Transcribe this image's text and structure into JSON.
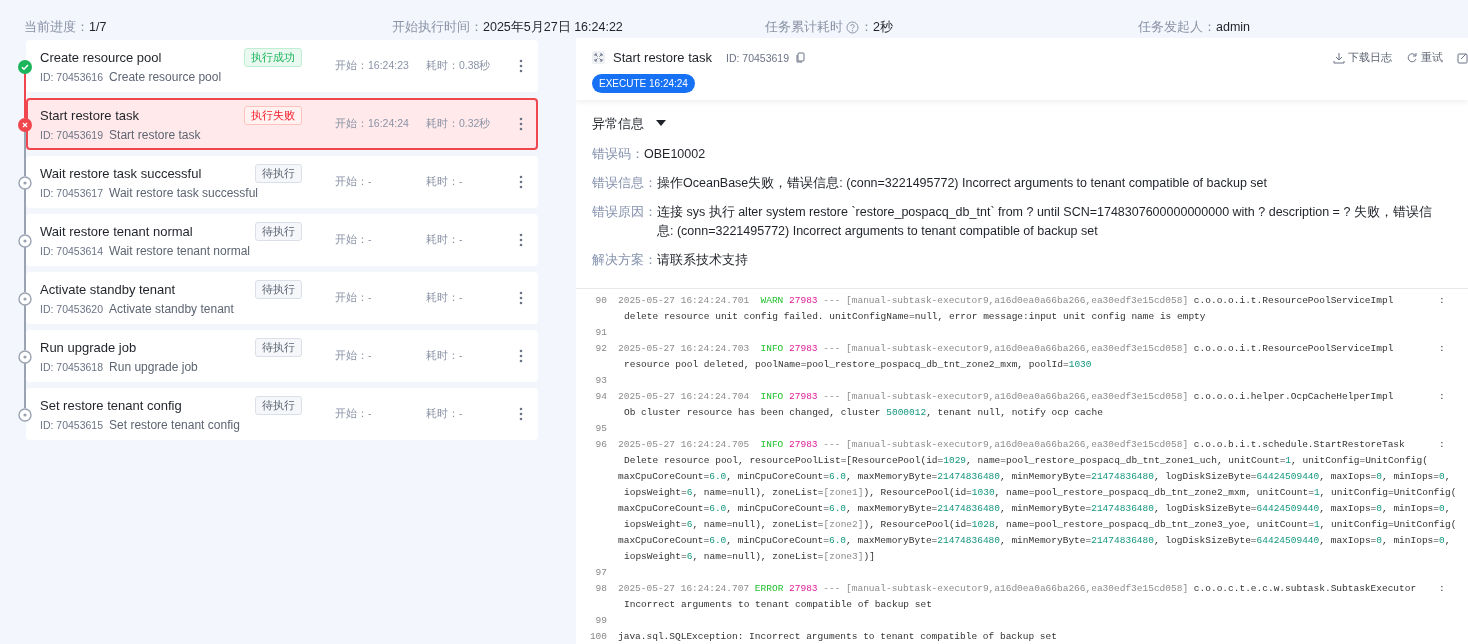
{
  "summary": [
    {
      "label": "当前进度：",
      "value": "1/7"
    },
    {
      "label": "开始执行时间：",
      "value": "2025年5月27日 16:24:22"
    },
    {
      "label": "任务累计耗时",
      "help": true,
      "label_after": "：",
      "value": "2秒"
    },
    {
      "label": "任务发起人：",
      "value": "admin"
    }
  ],
  "steps": [
    {
      "title": "Create resource pool",
      "kind": "success",
      "tag": "执行成功",
      "id": "ID: 70453616",
      "name": "Create resource pool",
      "start": "开始：16:24:23",
      "duration": "耗时：0.38秒",
      "selected": false
    },
    {
      "title": "Start restore task",
      "kind": "failed",
      "tag": "执行失败",
      "id": "ID: 70453619",
      "name": "Start restore task",
      "start": "开始：16:24:24",
      "duration": "耗时：0.32秒",
      "selected": true
    },
    {
      "title": "Wait restore task successful",
      "kind": "pending",
      "tag": "待执行",
      "id": "ID: 70453617",
      "name": "Wait restore task successful",
      "start": "开始：-",
      "duration": "耗时：-",
      "selected": false
    },
    {
      "title": "Wait restore tenant normal",
      "kind": "pending",
      "tag": "待执行",
      "id": "ID: 70453614",
      "name": "Wait restore tenant normal",
      "start": "开始：-",
      "duration": "耗时：-",
      "selected": false
    },
    {
      "title": "Activate standby tenant",
      "kind": "pending",
      "tag": "待执行",
      "id": "ID: 70453620",
      "name": "Activate standby tenant",
      "start": "开始：-",
      "duration": "耗时：-",
      "selected": false
    },
    {
      "title": "Run upgrade job",
      "kind": "pending",
      "tag": "待执行",
      "id": "ID: 70453618",
      "name": "Run upgrade job",
      "start": "开始：-",
      "duration": "耗时：-",
      "selected": false
    },
    {
      "title": "Set restore tenant config",
      "kind": "pending",
      "tag": "待执行",
      "id": "ID: 70453615",
      "name": "Set restore tenant config",
      "start": "开始：-",
      "duration": "耗时：-",
      "selected": false
    }
  ],
  "detail": {
    "title": "Start restore task",
    "id": "ID: 70453619",
    "actions": [
      "下载日志",
      "重试"
    ],
    "badge": "EXECUTE 16:24:24"
  },
  "error_info": {
    "title": "异常信息",
    "expanded": true,
    "rows": [
      {
        "label": "错误码：",
        "value": "OBE10002"
      },
      {
        "label": "错误信息：",
        "value": "操作OceanBase失败，错误信息: (conn=3221495772) Incorrect arguments to tenant compatible of backup set"
      },
      {
        "label": "错误原因：",
        "value": "连接 sys 执行 alter system restore `restore_pospacq_db_tnt` from ? until SCN=1748307600000000000 with ? description = ? 失败，错误信息: (conn=3221495772) Incorrect arguments to tenant compatible of backup set"
      },
      {
        "label": "解决方案：",
        "value": "请联系技术支持"
      }
    ]
  },
  "log": [
    {
      "no": "90",
      "kind": "record",
      "time": "2025-05-27 16:24:24.701",
      "level": "WARN",
      "pid": "27983",
      "sep": "---",
      "thread": "[manual-subtask-executor9,a16d0ea0a66ba266,ea30edf3e15cd058]",
      "logger": "c.o.o.o.i.t.ResourcePoolServiceImpl",
      "colon": ":",
      "body": [
        [
          {
            "kind": "text",
            "text": "delete resource unit config failed. unitConfigName=null, error message:input unit config name is empty"
          }
        ]
      ]
    },
    {
      "no": "91",
      "kind": "blank"
    },
    {
      "no": "92",
      "kind": "record",
      "time": "2025-05-27 16:24:24.703",
      "level": "INFO",
      "pid": "27983",
      "sep": "---",
      "thread": "[manual-subtask-executor9,a16d0ea0a66ba266,ea30edf3e15cd058]",
      "logger": "c.o.o.o.i.t.ResourcePoolServiceImpl",
      "colon": ":",
      "body": [
        [
          {
            "kind": "text",
            "text": "resource pool deleted, poolName=pool_restore_pospacq_db_tnt_zone2_mxm, poolId="
          },
          {
            "kind": "num",
            "text": "1030"
          }
        ]
      ]
    },
    {
      "no": "93",
      "kind": "blank"
    },
    {
      "no": "94",
      "kind": "record",
      "time": "2025-05-27 16:24:24.704",
      "level": "INFO",
      "pid": "27983",
      "sep": "---",
      "thread": "[manual-subtask-executor9,a16d0ea0a66ba266,ea30edf3e15cd058]",
      "logger": "c.o.o.o.i.helper.OcpCacheHelperImpl",
      "colon": ":",
      "body": [
        [
          {
            "kind": "text",
            "text": "Ob cluster resource has been changed, cluster "
          },
          {
            "kind": "num",
            "text": "5000012"
          },
          {
            "kind": "text",
            "text": ", tenant null, notify ocp cache"
          }
        ]
      ]
    },
    {
      "no": "95",
      "kind": "blank"
    },
    {
      "no": "96",
      "kind": "record",
      "time": "2025-05-27 16:24:24.705",
      "level": "INFO",
      "pid": "27983",
      "sep": "---",
      "thread": "[manual-subtask-executor9,a16d0ea0a66ba266,ea30edf3e15cd058]",
      "logger": "c.o.o.b.i.t.schedule.StartRestoreTask",
      "colon": ":",
      "body": [
        [
          {
            "kind": "text",
            "text": "Delete resource pool, resourcePoolList=[ResourcePool(id="
          },
          {
            "kind": "num",
            "text": "1029"
          },
          {
            "kind": "text",
            "text": ", name=pool_restore_pospacq_db_tnt_zone1_uch, unitCount="
          },
          {
            "kind": "num",
            "text": "1"
          },
          {
            "kind": "text",
            "text": ", unitConfig=UnitConfig("
          }
        ],
        [
          {
            "kind": "text",
            "text": "maxCpuCoreCount="
          },
          {
            "kind": "num",
            "text": "6.0"
          },
          {
            "kind": "text",
            "text": ", minCpuCoreCount="
          },
          {
            "kind": "num",
            "text": "6.0"
          },
          {
            "kind": "text",
            "text": ", maxMemoryByte="
          },
          {
            "kind": "num",
            "text": "21474836480"
          },
          {
            "kind": "text",
            "text": ", minMemoryByte="
          },
          {
            "kind": "num",
            "text": "21474836480"
          },
          {
            "kind": "text",
            "text": ", logDiskSizeByte="
          },
          {
            "kind": "num",
            "text": "64424509440"
          },
          {
            "kind": "text",
            "text": ", maxIops="
          },
          {
            "kind": "num",
            "text": "0"
          },
          {
            "kind": "text",
            "text": ", minIops="
          },
          {
            "kind": "num",
            "text": "0"
          },
          {
            "kind": "text",
            "text": ","
          }
        ],
        [
          {
            "kind": "text",
            "text": "iopsWeight="
          },
          {
            "kind": "num",
            "text": "6"
          },
          {
            "kind": "text",
            "text": ", name=null), zoneList="
          },
          {
            "kind": "dim",
            "text": "[zone1]"
          },
          {
            "kind": "text",
            "text": "), ResourcePool(id="
          },
          {
            "kind": "num",
            "text": "1030"
          },
          {
            "kind": "text",
            "text": ", name=pool_restore_pospacq_db_tnt_zone2_mxm, unitCount="
          },
          {
            "kind": "num",
            "text": "1"
          },
          {
            "kind": "text",
            "text": ", unitConfig=UnitConfig("
          }
        ],
        [
          {
            "kind": "text",
            "text": "maxCpuCoreCount="
          },
          {
            "kind": "num",
            "text": "6.0"
          },
          {
            "kind": "text",
            "text": ", minCpuCoreCount="
          },
          {
            "kind": "num",
            "text": "6.0"
          },
          {
            "kind": "text",
            "text": ", maxMemoryByte="
          },
          {
            "kind": "num",
            "text": "21474836480"
          },
          {
            "kind": "text",
            "text": ", minMemoryByte="
          },
          {
            "kind": "num",
            "text": "21474836480"
          },
          {
            "kind": "text",
            "text": ", logDiskSizeByte="
          },
          {
            "kind": "num",
            "text": "64424509440"
          },
          {
            "kind": "text",
            "text": ", maxIops="
          },
          {
            "kind": "num",
            "text": "0"
          },
          {
            "kind": "text",
            "text": ", minIops="
          },
          {
            "kind": "num",
            "text": "0"
          },
          {
            "kind": "text",
            "text": ","
          }
        ],
        [
          {
            "kind": "text",
            "text": "iopsWeight="
          },
          {
            "kind": "num",
            "text": "6"
          },
          {
            "kind": "text",
            "text": ", name=null), zoneList="
          },
          {
            "kind": "dim",
            "text": "[zone2]"
          },
          {
            "kind": "text",
            "text": "), ResourcePool(id="
          },
          {
            "kind": "num",
            "text": "1028"
          },
          {
            "kind": "text",
            "text": ", name=pool_restore_pospacq_db_tnt_zone3_yoe, unitCount="
          },
          {
            "kind": "num",
            "text": "1"
          },
          {
            "kind": "text",
            "text": ", unitConfig=UnitConfig("
          }
        ],
        [
          {
            "kind": "text",
            "text": "maxCpuCoreCount="
          },
          {
            "kind": "num",
            "text": "6.0"
          },
          {
            "kind": "text",
            "text": ", minCpuCoreCount="
          },
          {
            "kind": "num",
            "text": "6.0"
          },
          {
            "kind": "text",
            "text": ", maxMemoryByte="
          },
          {
            "kind": "num",
            "text": "21474836480"
          },
          {
            "kind": "text",
            "text": ", minMemoryByte="
          },
          {
            "kind": "num",
            "text": "21474836480"
          },
          {
            "kind": "text",
            "text": ", logDiskSizeByte="
          },
          {
            "kind": "num",
            "text": "64424509440"
          },
          {
            "kind": "text",
            "text": ", maxIops="
          },
          {
            "kind": "num",
            "text": "0"
          },
          {
            "kind": "text",
            "text": ", minIops="
          },
          {
            "kind": "num",
            "text": "0"
          },
          {
            "kind": "text",
            "text": ","
          }
        ],
        [
          {
            "kind": "text",
            "text": "iopsWeight="
          },
          {
            "kind": "num",
            "text": "6"
          },
          {
            "kind": "text",
            "text": ", name=null), zoneList="
          },
          {
            "kind": "dim",
            "text": "[zone3]"
          },
          {
            "kind": "text",
            "text": ")]"
          }
        ]
      ]
    },
    {
      "no": "97",
      "kind": "blank"
    },
    {
      "no": "98",
      "kind": "record",
      "time": "2025-05-27 16:24:24.707",
      "level": "ERROR",
      "pid": "27983",
      "sep": "---",
      "thread": "[manual-subtask-executor9,a16d0ea0a66ba266,ea30edf3e15cd058]",
      "logger": "c.o.o.c.t.e.c.w.subtask.SubtaskExecutor",
      "colon": ":",
      "body": [
        [
          {
            "kind": "text",
            "text": "Incorrect arguments to tenant compatible of backup set"
          }
        ]
      ]
    },
    {
      "no": "99",
      "kind": "blank"
    },
    {
      "no": "100",
      "kind": "plain",
      "text": "java.sql.SQLException: Incorrect arguments to tenant compatible of backup set"
    }
  ]
}
